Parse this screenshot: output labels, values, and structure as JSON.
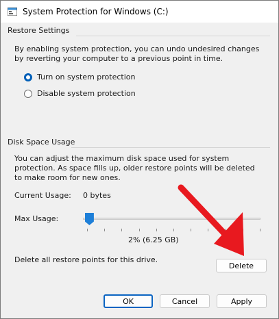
{
  "window": {
    "title": "System Protection for Windows (C:)"
  },
  "restore_settings": {
    "heading": "Restore Settings",
    "description": "By enabling system protection, you can undo undesired changes by reverting your computer to a previous point in time.",
    "options": [
      {
        "label": "Turn on system protection",
        "selected": true
      },
      {
        "label": "Disable system protection",
        "selected": false
      }
    ]
  },
  "disk_space": {
    "heading": "Disk Space Usage",
    "description": "You can adjust the maximum disk space used for system protection. As space fills up, older restore points will be deleted to make room for new ones.",
    "current_usage_label": "Current Usage:",
    "current_usage_value": "0 bytes",
    "max_usage_label": "Max Usage:",
    "max_usage_percent": 2,
    "max_usage_text": "2% (6.25 GB)",
    "delete_prompt": "Delete all restore points for this drive.",
    "delete_label": "Delete"
  },
  "footer": {
    "ok_label": "OK",
    "cancel_label": "Cancel",
    "apply_label": "Apply"
  },
  "colors": {
    "accent": "#005fb8",
    "slider_thumb": "#1e7fd8",
    "annotation_arrow": "#e8191f"
  }
}
